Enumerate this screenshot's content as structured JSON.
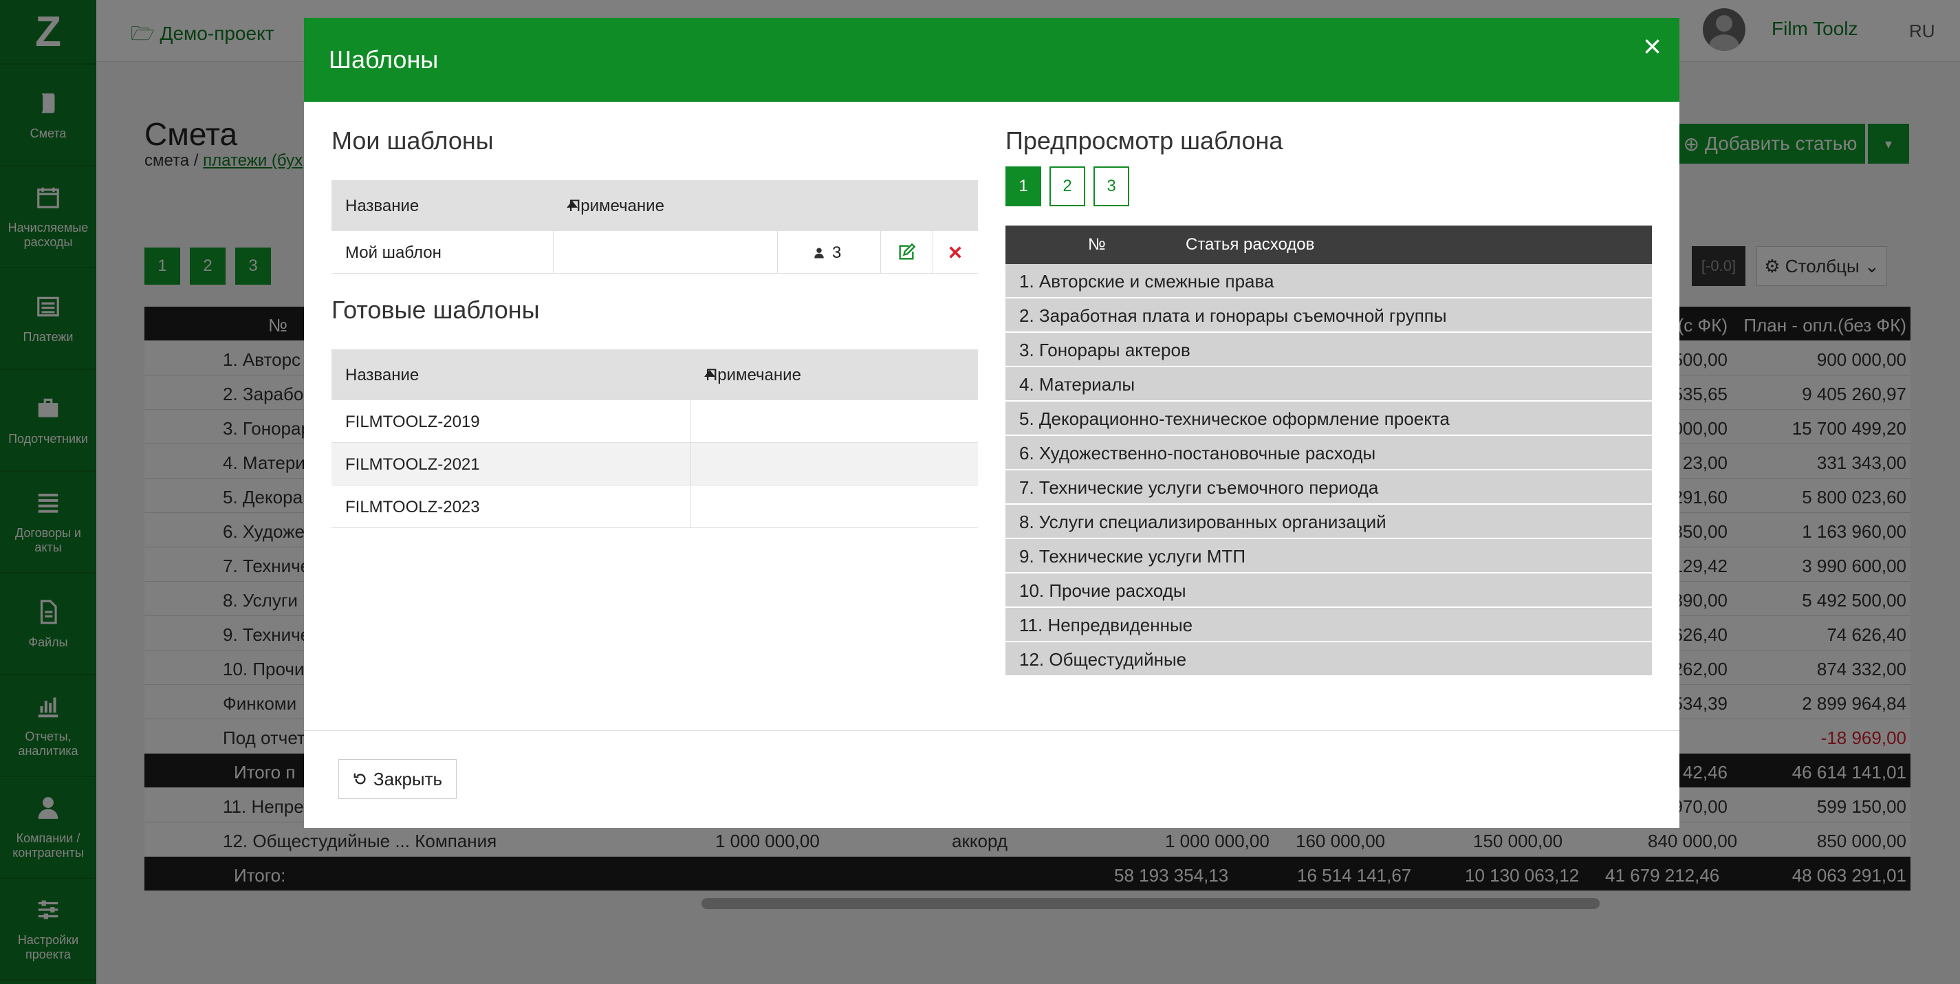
{
  "app": {
    "logo": "Z",
    "project": "Демо-проект",
    "user": "Film Toolz",
    "lang": "RU"
  },
  "sidebar": {
    "items": [
      {
        "label": "Смета",
        "icon": "book-icon"
      },
      {
        "label": "Начисляемые расходы",
        "icon": "calendar-icon"
      },
      {
        "label": "Платежи",
        "icon": "list-icon"
      },
      {
        "label": "Подотчетники",
        "icon": "briefcase-icon"
      },
      {
        "label": "Договоры и акты",
        "icon": "list-lines-icon"
      },
      {
        "label": "Файлы",
        "icon": "file-icon"
      },
      {
        "label": "Отчеты, аналитика",
        "icon": "bar-chart-icon"
      },
      {
        "label": "Компании / контрагенты",
        "icon": "user-icon"
      },
      {
        "label": "Настройки проекта",
        "icon": "sliders-icon"
      }
    ]
  },
  "page": {
    "title": "Смета",
    "crumb_1": "смета /",
    "crumb_2": "платежи (бух",
    "add_button": "Добавить статью",
    "pages": [
      "1",
      "2",
      "3"
    ],
    "range": "[-0.0]",
    "columns_button": "Столбцы"
  },
  "bg_table": {
    "head": {
      "left": "№",
      "right": "План - опл.(без ФК)",
      "mid": "(с ФК)"
    },
    "rows": [
      {
        "name": "1. Авторс",
        "mid": "500,00",
        "right": "900 000,00"
      },
      {
        "name": "2. Зарабо",
        "mid": "535,65",
        "right": "9 405 260,97"
      },
      {
        "name": "3. Гонорар",
        "mid": "000,00",
        "right": "15 700 499,20"
      },
      {
        "name": "4. Матери",
        "mid": "23,00",
        "right": "331 343,00"
      },
      {
        "name": "5. Декора",
        "mid": "291,60",
        "right": "5 800 023,60"
      },
      {
        "name": "6. Художе",
        "mid": "350,00",
        "right": "1 163 960,00"
      },
      {
        "name": "7. Техниче",
        "mid": "129,42",
        "right": "3 990 600,00"
      },
      {
        "name": "8. Услуги",
        "mid": "390,00",
        "right": "5 492 500,00"
      },
      {
        "name": "9. Техниче",
        "mid": "626,40",
        "right": "74 626,40"
      },
      {
        "name": "10. Прочи",
        "mid": "262,00",
        "right": "874 332,00"
      },
      {
        "name": "Финкоми",
        "mid": "534,39",
        "right": "2 899 964,84"
      },
      {
        "name": "Под отчет",
        "mid": "",
        "right": "-18 969,00"
      }
    ],
    "subtotal": {
      "name": "Итого п",
      "mid": "42,46",
      "right": "46 614 141,01"
    },
    "row11": {
      "name": "11. Непре",
      "mid": "970,00",
      "right": "599 150,00"
    },
    "row12": {
      "name": "12. Общестудийные ... Компания",
      "c1": "1 000 000,00",
      "c2": "аккорд",
      "c3": "1 000 000,00",
      "c4": "160 000,00",
      "c5": "150 000,00",
      "c6": "840 000,00",
      "right": "850 000,00"
    },
    "total": {
      "name": "Итого:",
      "c1": "58 193 354,13",
      "c2": "16 514 141,67",
      "c3": "10 130 063,12",
      "c4": "41 679 212,46",
      "right": "48 063 291,01"
    }
  },
  "modal": {
    "title": "Шаблоны",
    "close_x": "×",
    "my_templates": {
      "title": "Мои шаблоны",
      "col_name": "Название",
      "col_note": "Примечание",
      "rows": [
        {
          "name": "Мой шаблон",
          "note": "",
          "count": "3"
        }
      ]
    },
    "ready_templates": {
      "title": "Готовые шаблоны",
      "col_name": "Название",
      "col_note": "Примечание",
      "rows": [
        {
          "name": "FILMTOOLZ-2019",
          "note": ""
        },
        {
          "name": "FILMTOOLZ-2021",
          "note": ""
        },
        {
          "name": "FILMTOOLZ-2023",
          "note": ""
        }
      ]
    },
    "preview": {
      "title": "Предпросмотр шаблона",
      "pages": [
        "1",
        "2",
        "3"
      ],
      "active_page": "1",
      "col_num": "№",
      "col_item": "Статья расходов",
      "rows": [
        "1. Авторские и смежные права",
        "2. Заработная плата и гонорары съемочной группы",
        "3. Гонорары актеров",
        "4. Материалы",
        "5. Декорационно-техническое оформление проекта",
        "6. Художественно-постановочные расходы",
        "7. Технические услуги съемочного периода",
        "8. Услуги специализированных организаций",
        "9. Технические услуги МТП",
        "10. Прочие расходы",
        "11. Непредвиденные",
        "12. Общестудийные"
      ]
    },
    "close_button": "Закрыть"
  },
  "colors": {
    "brand_green": "#0f8c25",
    "delete_red": "#d9232d",
    "pointer_red": "#e02020"
  }
}
